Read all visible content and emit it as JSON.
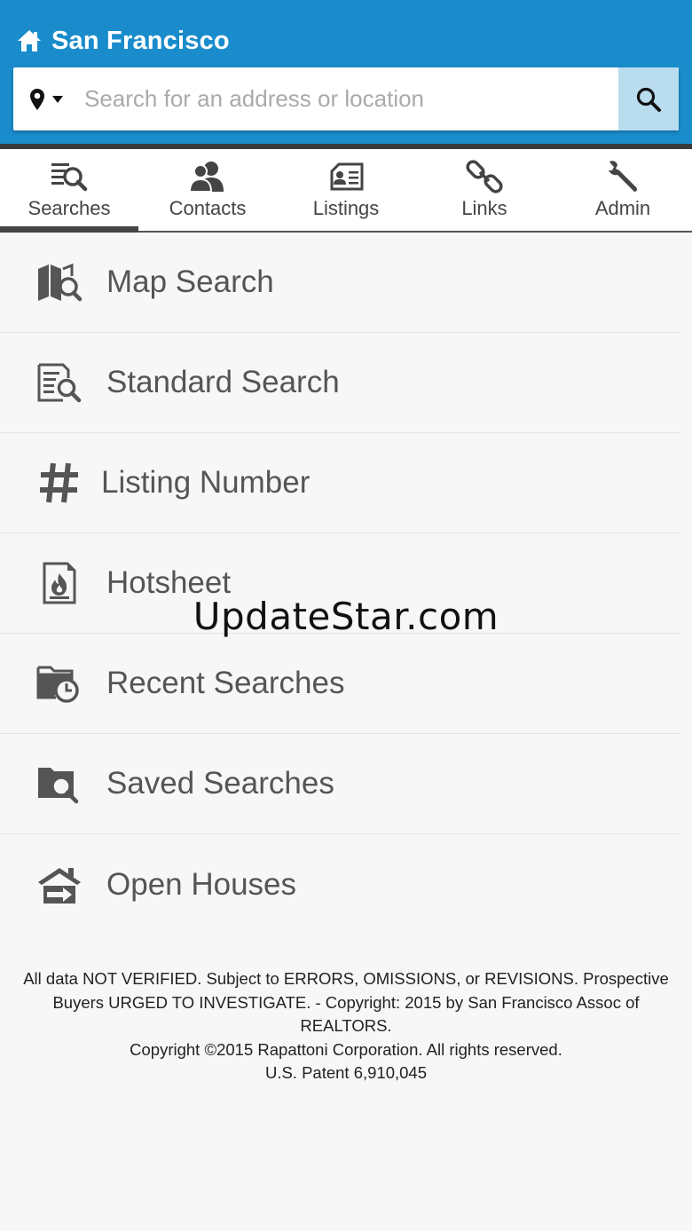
{
  "header": {
    "title": "San Francisco",
    "brand_color": "#1a8ccc",
    "home_icon": "home-icon"
  },
  "search": {
    "placeholder": "Search for an address or location",
    "value": "",
    "location_icon": "map-pin-icon",
    "dropdown_icon": "caret-down-icon",
    "submit_icon": "search-icon"
  },
  "tabs": [
    {
      "label": "Searches",
      "icon": "search-list-icon",
      "active": true
    },
    {
      "label": "Contacts",
      "icon": "contacts-icon",
      "active": false
    },
    {
      "label": "Listings",
      "icon": "listings-icon",
      "active": false
    },
    {
      "label": "Links",
      "icon": "link-icon",
      "active": false
    },
    {
      "label": "Admin",
      "icon": "wrench-icon",
      "active": false
    }
  ],
  "menu": [
    {
      "label": "Map Search",
      "icon": "map-search-icon"
    },
    {
      "label": "Standard Search",
      "icon": "document-search-icon"
    },
    {
      "label": "Listing Number",
      "icon": "hash-icon"
    },
    {
      "label": "Hotsheet",
      "icon": "fire-document-icon"
    },
    {
      "label": "Recent Searches",
      "icon": "folder-clock-icon"
    },
    {
      "label": "Saved Searches",
      "icon": "folder-search-icon"
    },
    {
      "label": "Open Houses",
      "icon": "house-arrow-icon"
    }
  ],
  "watermark": "UpdateStar.com",
  "footer": {
    "line1": "All data NOT VERIFIED. Subject to ERRORS, OMISSIONS, or REVISIONS. Prospective Buyers URGED TO INVESTIGATE. - Copyright: 2015 by San Francisco Assoc of REALTORS.",
    "line2": "Copyright ©2015 Rapattoni Corporation. All rights reserved.",
    "line3": "U.S. Patent 6,910,045"
  }
}
